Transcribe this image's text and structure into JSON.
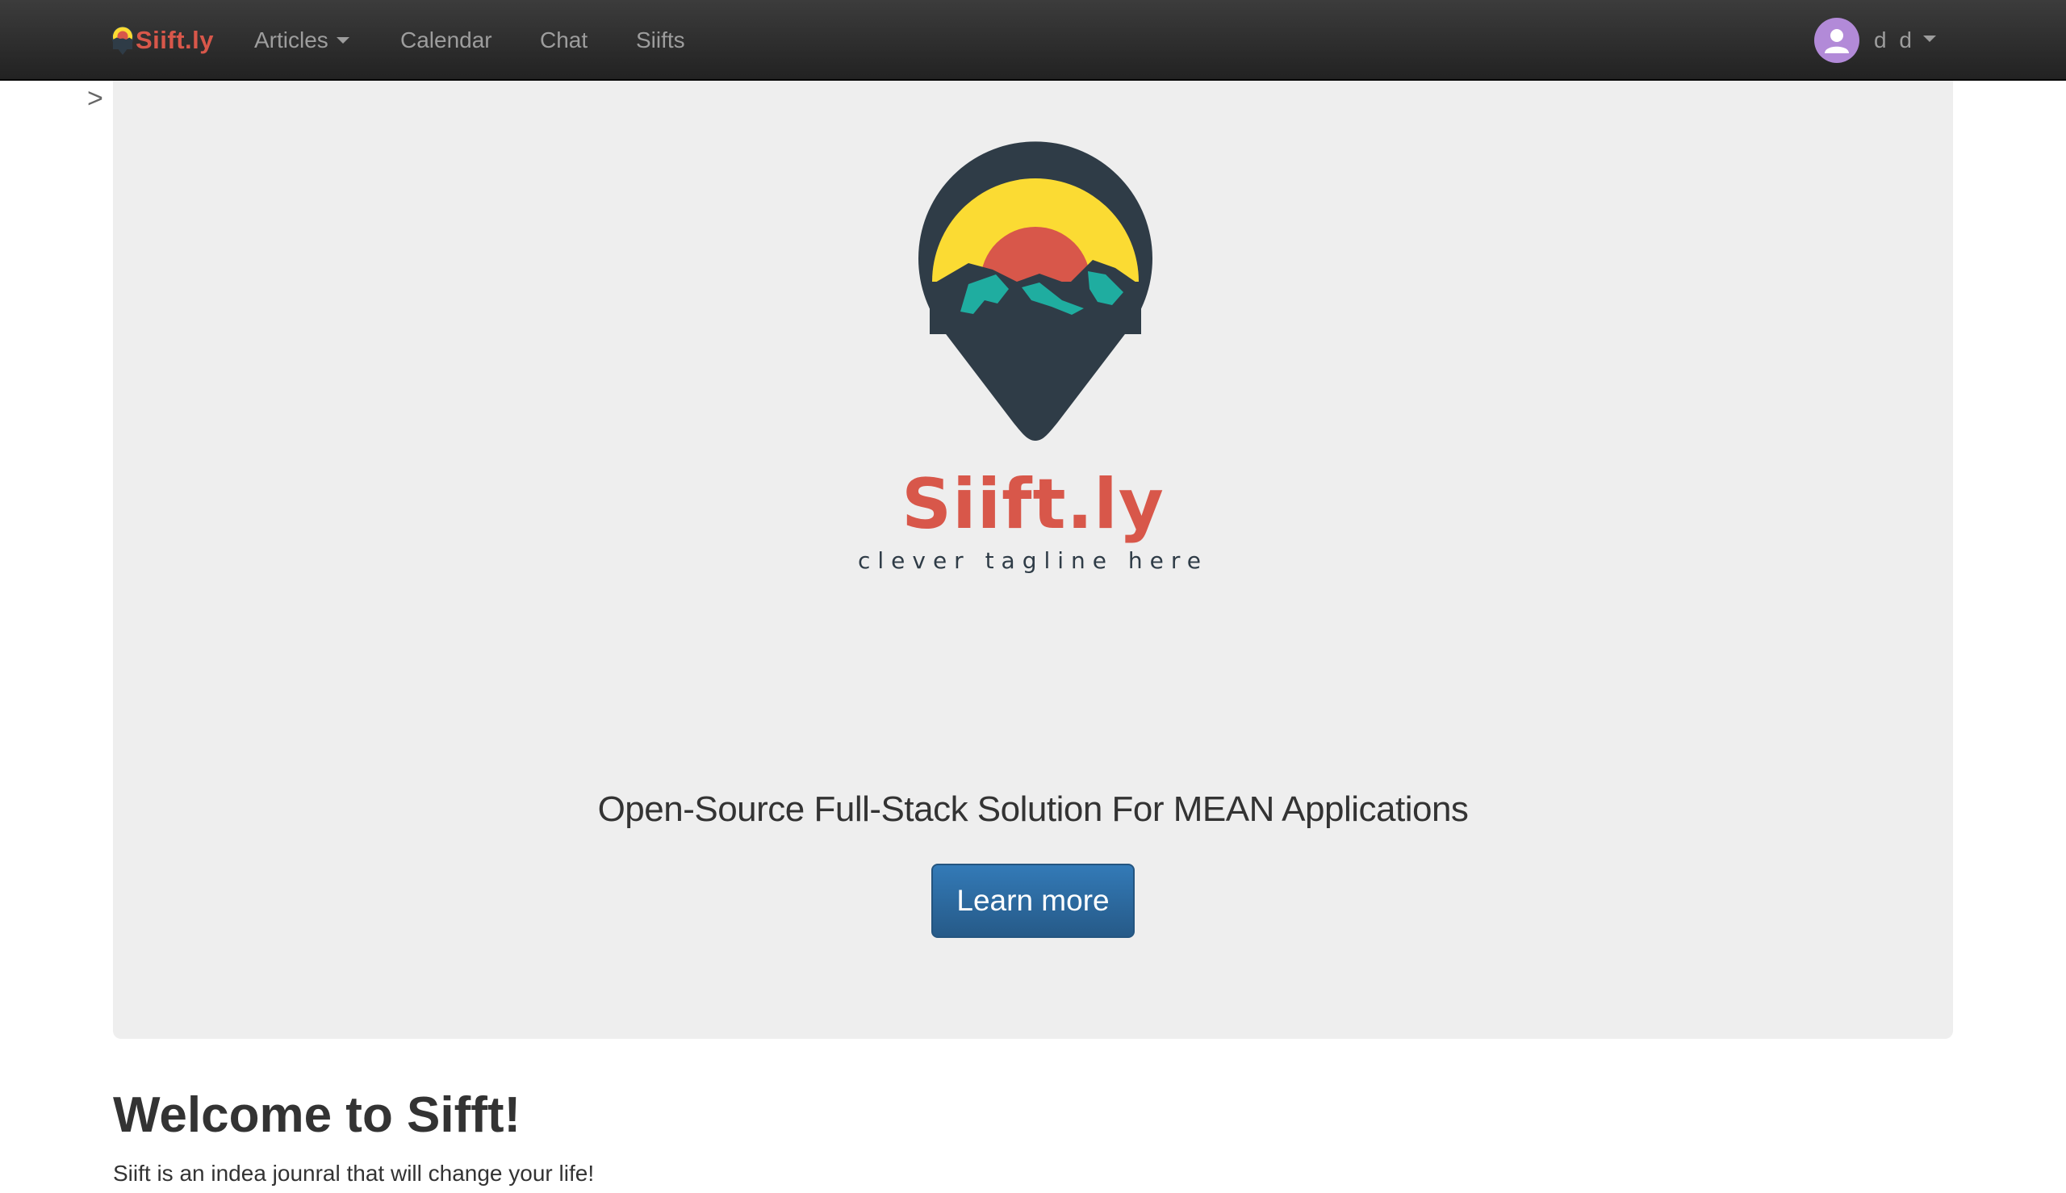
{
  "navbar": {
    "brand": "Siift.ly",
    "links": [
      {
        "label": "Articles",
        "has_dropdown": true
      },
      {
        "label": "Calendar",
        "has_dropdown": false
      },
      {
        "label": "Chat",
        "has_dropdown": false
      },
      {
        "label": "Siifts",
        "has_dropdown": false
      }
    ],
    "user": {
      "name": "d d",
      "avatar_icon": "user-avatar-icon",
      "avatar_color": "#b28ad8"
    }
  },
  "sidebar_toggle": ">",
  "hero": {
    "logo_name": "Siift.ly",
    "logo_tagline": "clever tagline here",
    "headline": "Open-Source Full-Stack Solution For MEAN Applications",
    "button_label": "Learn more"
  },
  "welcome": {
    "title": "Welcome to Sifft!",
    "text": "Siift is an indea jounral that will change your life!"
  },
  "colors": {
    "brand_red": "#d8574a",
    "logo_dark": "#2f3c47",
    "logo_yellow": "#fbdb33",
    "logo_teal": "#1fada0",
    "primary_button": "#337ab7"
  }
}
